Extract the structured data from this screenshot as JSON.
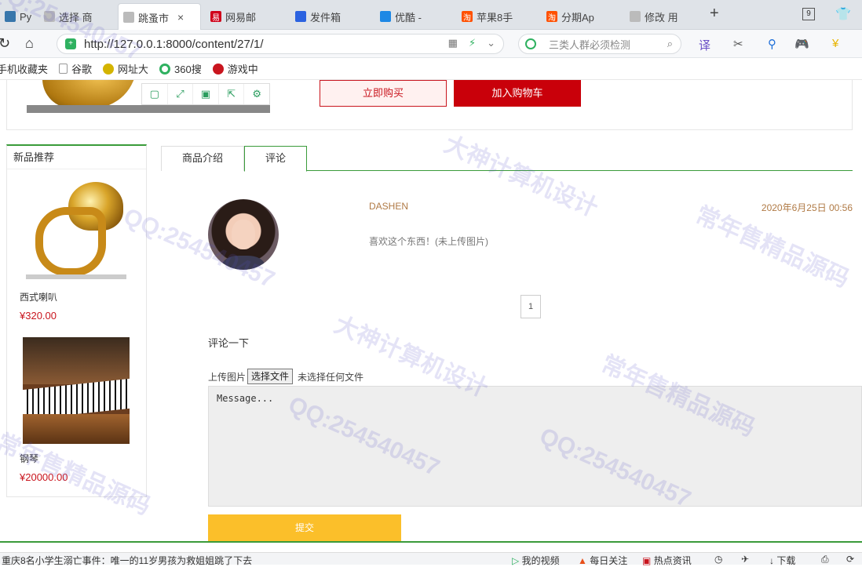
{
  "browser": {
    "tabs": [
      {
        "label": "Py",
        "icon": "python-icon",
        "color": "#3776ab"
      },
      {
        "label": "选择 商",
        "icon": "page-icon",
        "color": "#999999"
      },
      {
        "label": "跳蚤市",
        "icon": "page-icon",
        "color": "#999999",
        "active": true
      },
      {
        "label": "网易邮",
        "icon": "netease-icon",
        "color": "#d0021b"
      },
      {
        "label": "发件箱",
        "icon": "baidu-paw-icon",
        "color": "#2b62e0"
      },
      {
        "label": "优酷 -",
        "icon": "youku-icon",
        "color": "#1e88e5"
      },
      {
        "label": "苹果8手",
        "icon": "taobao-icon",
        "color": "#ff5000"
      },
      {
        "label": "分期Ap",
        "icon": "taobao-icon",
        "color": "#ff5000"
      },
      {
        "label": "修改 用",
        "icon": "page-icon",
        "color": "#999999"
      }
    ],
    "tab_close": "×",
    "new_tab": "+",
    "tab_count": "9",
    "url": "http://127.0.0.1:8000/content/27/1/",
    "search_placeholder": "三类人群必须检测",
    "bookmarks": [
      {
        "label": "手机收藏夹",
        "color": "#f6a623"
      },
      {
        "label": "谷歌",
        "color": "#999999"
      },
      {
        "label": "网址大",
        "color": "#d4b400"
      },
      {
        "label": "360搜",
        "color": "#2fb160"
      },
      {
        "label": "游戏中",
        "color": "#c9151e"
      }
    ]
  },
  "product": {
    "buy_now": "立即购买",
    "add_to_cart": "加入购物车"
  },
  "sidebar": {
    "title": "新品推荐",
    "items": [
      {
        "name": "西式喇叭",
        "price": "¥320.00"
      },
      {
        "name": "钢琴",
        "price": "¥20000.00"
      }
    ]
  },
  "tabs": {
    "intro": "商品介绍",
    "comments": "评论"
  },
  "comment": {
    "user": "DASHEN",
    "date": "2020年6月25日 00:56",
    "text": "喜欢这个东西！(未上传图片)"
  },
  "pagination": {
    "current": "1"
  },
  "form": {
    "title": "评论一下",
    "upload_label": "上传图片",
    "choose_file": "选择文件",
    "no_file": "未选择任何文件",
    "message_placeholder": "Message...",
    "submit": "提交"
  },
  "statusbar": {
    "news": "重庆8名小学生溺亡事件：唯一的11岁男孩为救姐姐跳了下去",
    "my_video": "我的视频",
    "daily_focus": "每日关注",
    "hot_news": "热点资讯",
    "download": "下载"
  },
  "watermark": {
    "qq": "QQ:254540457",
    "design": "大神计算机设计",
    "source": "常年售精品源码"
  }
}
